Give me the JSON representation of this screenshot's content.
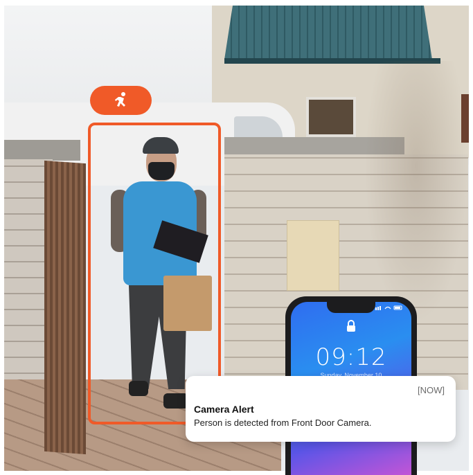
{
  "phone": {
    "time": "09:12",
    "date": "Sunday, November 10"
  },
  "notification": {
    "timestamp": "[NOW]",
    "title": "Camera Alert",
    "message": "Person is detected from Front Door Camera."
  },
  "detection": {
    "badge_icon": "running-person-icon",
    "accent_color": "#f05a28"
  }
}
